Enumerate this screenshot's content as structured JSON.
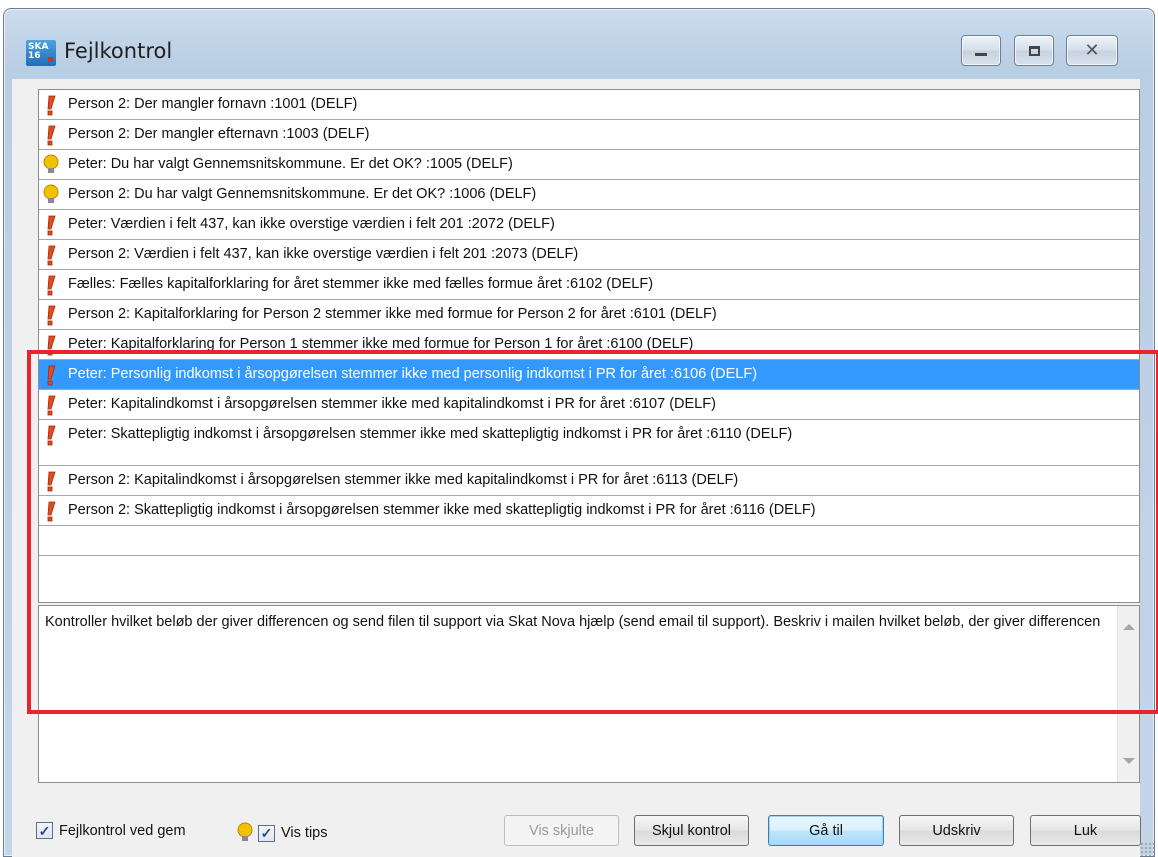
{
  "window": {
    "title": "Fejlkontrol",
    "icon_text": "SKA\n16",
    "close_glyph": "✕"
  },
  "messages": [
    {
      "icon": "exclamation-icon",
      "text": "Person 2: Der mangler fornavn :1001 (DELF)"
    },
    {
      "icon": "exclamation-icon",
      "text": "Person 2: Der mangler efternavn :1003 (DELF)"
    },
    {
      "icon": "lightbulb-icon",
      "text": "Peter: Du har valgt Gennemsnitskommune. Er det OK? :1005 (DELF)"
    },
    {
      "icon": "lightbulb-icon",
      "text": "Person 2: Du har valgt Gennemsnitskommune. Er det OK? :1006 (DELF)"
    },
    {
      "icon": "exclamation-icon",
      "text": "Peter: Værdien i felt 437, kan ikke overstige værdien i felt 201 :2072 (DELF)"
    },
    {
      "icon": "exclamation-icon",
      "text": "Person 2: Værdien i felt 437, kan ikke overstige værdien i felt 201 :2073 (DELF)"
    },
    {
      "icon": "exclamation-icon",
      "text": "Fælles: Fælles kapitalforklaring for året stemmer ikke med fælles formue året :6102 (DELF)"
    },
    {
      "icon": "exclamation-icon",
      "text": "Person 2: Kapitalforklaring for Person 2 stemmer ikke med formue for Person 2 for året :6101 (DELF)"
    },
    {
      "icon": "exclamation-icon",
      "text": "Peter: Kapitalforklaring for Person 1 stemmer ikke med formue for Person 1 for året :6100 (DELF)"
    },
    {
      "icon": "exclamation-icon",
      "text": "Peter: Personlig indkomst i årsopgørelsen stemmer ikke med personlig indkomst i PR for året :6106 (DELF)",
      "selected": true
    },
    {
      "icon": "exclamation-icon",
      "text": "Peter: Kapitalindkomst i årsopgørelsen stemmer ikke med kapitalindkomst i PR for året :6107 (DELF)"
    },
    {
      "icon": "exclamation-icon",
      "text": "Peter: Skattepligtig indkomst i årsopgørelsen stemmer ikke med skattepligtig indkomst i PR for året :6110 (DELF)"
    },
    {
      "icon": "exclamation-icon",
      "text": "Person 2: Kapitalindkomst i årsopgørelsen stemmer ikke med kapitalindkomst i PR for året :6113 (DELF)"
    },
    {
      "icon": "exclamation-icon",
      "text": "Person 2: Skattepligtig indkomst i årsopgørelsen stemmer ikke med skattepligtig indkomst i PR for året :6116 (DELF)"
    }
  ],
  "detail": {
    "text": "Kontroller hvilket beløb der giver differencen og send filen til support via Skat Nova hjælp (send email til support). Beskriv i mailen hvilket beløb, der giver differencen"
  },
  "footer": {
    "check_save_label": "Fejlkontrol ved gem",
    "check_save_checked": true,
    "check_tips_label": "Vis tips",
    "check_tips_checked": true,
    "btn_show_hidden": "Vis skjulte",
    "btn_hide_check": "Skjul kontrol",
    "btn_goto": "Gå til",
    "btn_print": "Udskriv",
    "btn_close": "Luk"
  },
  "colors": {
    "selection": "#3399ff",
    "highlight_frame": "#e8242c"
  }
}
